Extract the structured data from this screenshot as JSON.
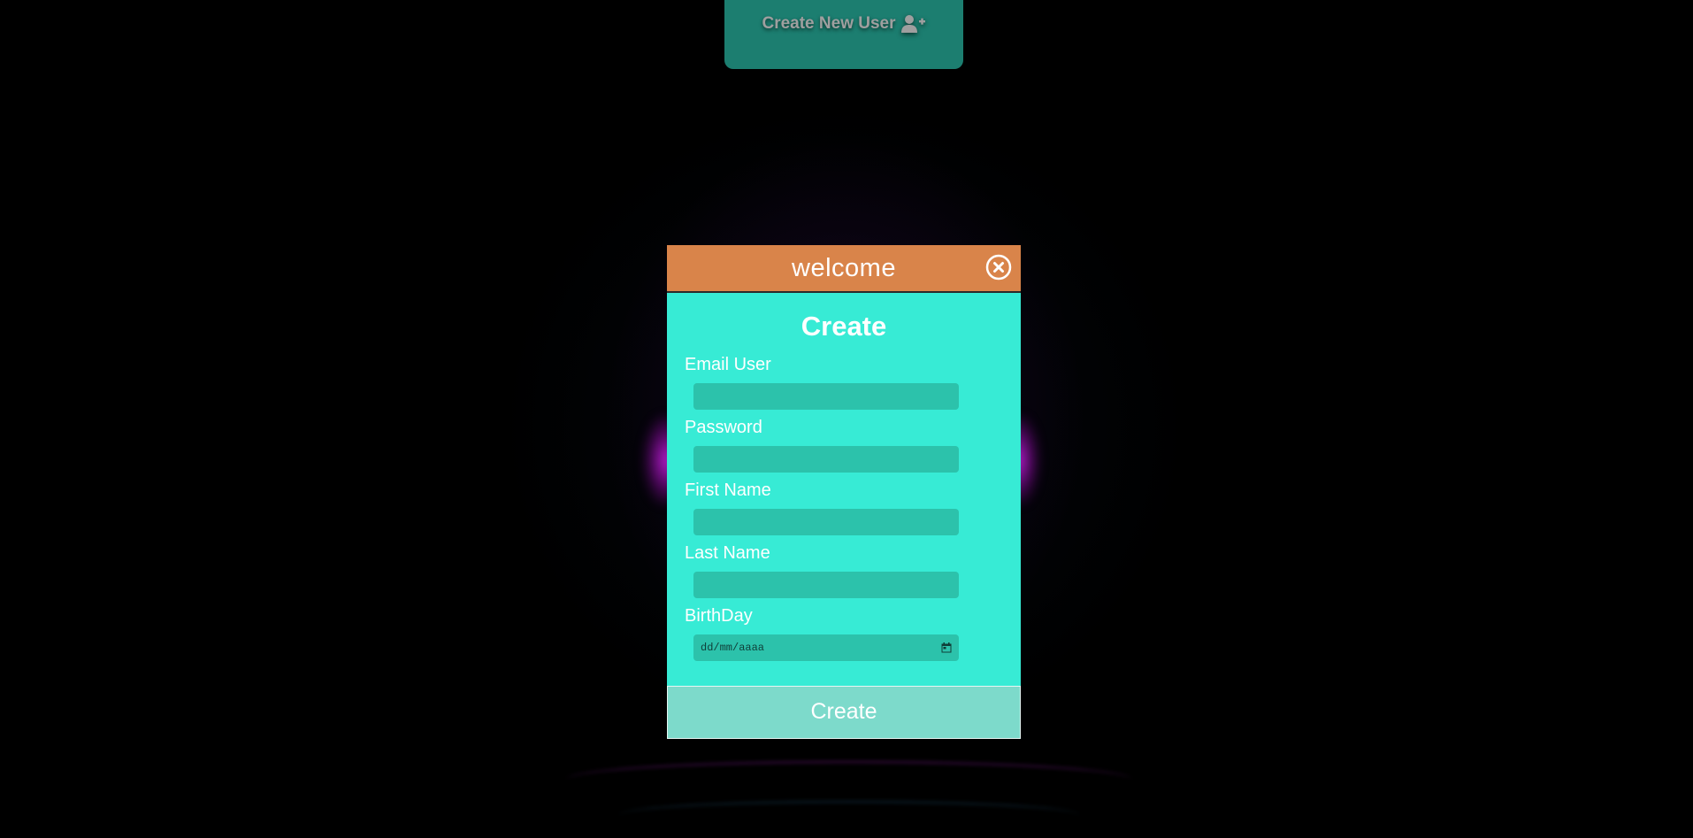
{
  "top_button": {
    "label": "Create New User",
    "icon": "user-plus-icon"
  },
  "modal": {
    "title": "welcome",
    "close_icon": "close-circle-icon",
    "heading": "Create",
    "fields": {
      "email": {
        "label": "Email User",
        "value": ""
      },
      "password": {
        "label": "Password",
        "value": ""
      },
      "first_name": {
        "label": "First Name",
        "value": ""
      },
      "last_name": {
        "label": "Last Name",
        "value": ""
      },
      "birthday": {
        "label": "BirthDay",
        "placeholder": "dd/mm/aaaa",
        "icon": "calendar-icon"
      }
    },
    "submit_label": "Create"
  },
  "colors": {
    "header": "#d9844a",
    "body": "#37ebd5",
    "input": "#2cc2ab",
    "submit": "#7ddacb",
    "top_button": "#1e8576"
  }
}
